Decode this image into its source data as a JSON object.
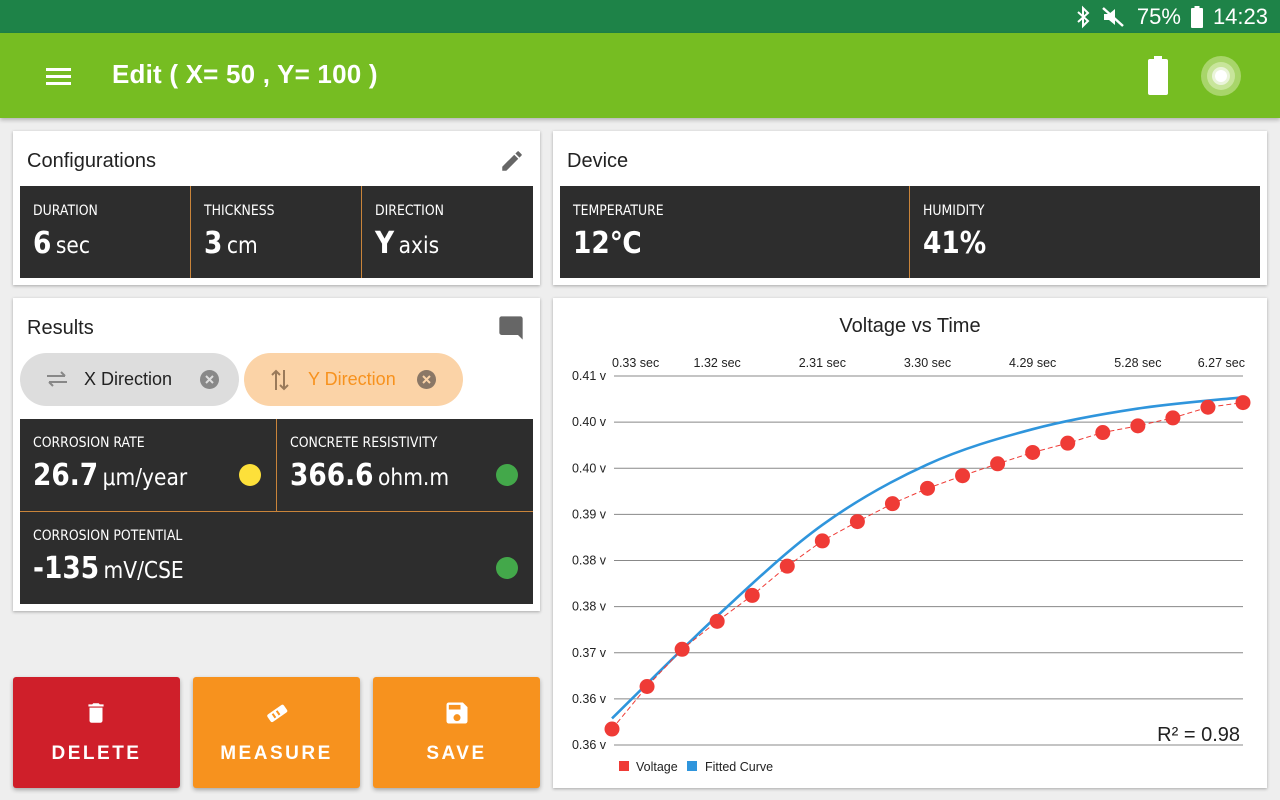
{
  "status_bar": {
    "battery_percent": "75%",
    "time": "14:23",
    "icons": [
      "bluetooth-icon",
      "mute-icon",
      "battery-icon"
    ]
  },
  "app_bar": {
    "title": "Edit ( X= 50 , Y= 100 )",
    "icons": [
      "menu-icon",
      "battery-icon",
      "signal-icon"
    ]
  },
  "configurations": {
    "title": "Configurations",
    "items": [
      {
        "label": "DURATION",
        "value": "6",
        "unit": "sec"
      },
      {
        "label": "THICKNESS",
        "value": "3",
        "unit": "cm"
      },
      {
        "label": "DIRECTION",
        "value": "Y",
        "unit": "axis"
      }
    ]
  },
  "device": {
    "title": "Device",
    "items": [
      {
        "label": "TEMPERATURE",
        "value": "12℃"
      },
      {
        "label": "HUMIDITY",
        "value": "41%"
      }
    ]
  },
  "results": {
    "title": "Results",
    "chips": [
      {
        "label": "X Direction",
        "selected": false
      },
      {
        "label": "Y Direction",
        "selected": true
      }
    ],
    "metrics": [
      {
        "label": "CORROSION RATE",
        "value": "26.7",
        "unit": "μm/year",
        "status_color": "#fde03a"
      },
      {
        "label": "CONCRETE RESISTIVITY",
        "value": "366.6",
        "unit": "ohm.m",
        "status_color": "#43a84a"
      },
      {
        "label": "CORROSION POTENTIAL",
        "value": "-135",
        "unit": "mV/CSE",
        "status_color": "#43a84a"
      }
    ]
  },
  "buttons": {
    "delete": "DELETE",
    "measure": "MEASURE",
    "save": "SAVE"
  },
  "colors": {
    "status_bar": "#1e8348",
    "app_bar": "#76bd22",
    "delete": "#cf1f2a",
    "measure": "#f7921e",
    "save": "#f7921e",
    "chip_selected": "#fbd3a7",
    "chip_selected_text": "#f7921e",
    "voltage": "#ef3b36",
    "fitted": "#2f95dc"
  },
  "chart_data": {
    "type": "scatter",
    "title": "Voltage vs Time",
    "x_tick_labels": [
      "0.33 sec",
      "1.32 sec",
      "2.31 sec",
      "3.30 sec",
      "4.29 sec",
      "5.28 sec",
      "6.27 sec"
    ],
    "x_ticks": [
      0.33,
      1.32,
      2.31,
      3.3,
      4.29,
      5.28,
      6.27
    ],
    "y_tick_labels": [
      "0.41 v",
      "0.40 v",
      "0.40 v",
      "0.39 v",
      "0.38 v",
      "0.38 v",
      "0.37 v",
      "0.36 v",
      "0.36 v"
    ],
    "ylim": [
      0.355,
      0.4105
    ],
    "xlim": [
      0.33,
      6.27
    ],
    "series": [
      {
        "name": "Voltage",
        "marker": "circle",
        "x": [
          0.33,
          0.66,
          0.99,
          1.32,
          1.65,
          1.98,
          2.31,
          2.64,
          2.97,
          3.3,
          3.63,
          3.96,
          4.29,
          4.62,
          4.95,
          5.28,
          5.61,
          5.94,
          6.27
        ],
        "y": [
          0.3574,
          0.3638,
          0.3694,
          0.3736,
          0.3775,
          0.3819,
          0.3857,
          0.3886,
          0.3913,
          0.3936,
          0.3955,
          0.3973,
          0.399,
          0.4004,
          0.402,
          0.403,
          0.4042,
          0.4058,
          0.4065
        ]
      },
      {
        "name": "Fitted Curve",
        "line": true,
        "x": [
          0.33,
          1.32,
          2.31,
          3.3,
          4.29,
          5.28,
          6.27
        ],
        "y": [
          0.359,
          0.3744,
          0.3881,
          0.3972,
          0.4025,
          0.4056,
          0.4073
        ]
      }
    ],
    "annotation": "R² = 0.98",
    "legend": "bottom-left",
    "grid": true
  }
}
